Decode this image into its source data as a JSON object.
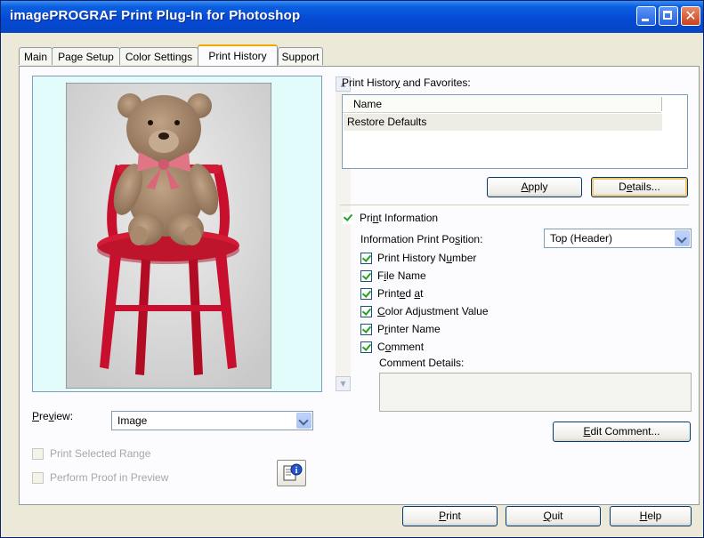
{
  "window": {
    "title": "imagePROGRAF Print Plug-In for Photoshop",
    "controls": {
      "minimize": "minimize",
      "maximize": "maximize",
      "close": "✕"
    }
  },
  "tabs": [
    {
      "label": "Main",
      "active": false
    },
    {
      "label": "Page Setup",
      "active": false
    },
    {
      "label": "Color Settings",
      "active": false
    },
    {
      "label": "Print History",
      "active": true
    },
    {
      "label": "Support",
      "active": false
    }
  ],
  "preview": {
    "image_description_icon": "teddy-bear-on-red-chair-photo",
    "label": "Preview:",
    "mode_value": "Image",
    "print_selected_range": {
      "label": "Print Selected Range",
      "checked": false,
      "enabled": false
    },
    "perform_proof": {
      "label": "Perform Proof in Preview",
      "checked": false,
      "enabled": false
    },
    "info_button_icon": "document-info-icon"
  },
  "history": {
    "section_label": "Print History and Favorites:",
    "column_name": "Name",
    "rows": [
      "Restore Defaults"
    ],
    "apply_label": "Apply",
    "details_label": "Details..."
  },
  "print_info": {
    "label": "Print Information",
    "checked": true,
    "position_label": "Information Print Position:",
    "position_value": "Top (Header)",
    "items": [
      {
        "label": "Print History Number",
        "checked": true
      },
      {
        "label": "File Name",
        "checked": true
      },
      {
        "label": "Printed at",
        "checked": true
      },
      {
        "label": "Color Adjustment Value",
        "checked": true
      },
      {
        "label": "Printer Name",
        "checked": true
      },
      {
        "label": "Comment",
        "checked": true
      }
    ],
    "comment_details_label": "Comment Details:",
    "comment_details_value": "",
    "edit_comment_label": "Edit Comment..."
  },
  "footer": {
    "print_label": "Print",
    "quit_label": "Quit",
    "help_label": "Help"
  },
  "colors": {
    "titlebar": "#0548d3",
    "dialog_bg": "#ece9d8",
    "preview_bg": "#e2fbfb",
    "chair_red": "#c8102e",
    "check_green": "#21a121"
  }
}
